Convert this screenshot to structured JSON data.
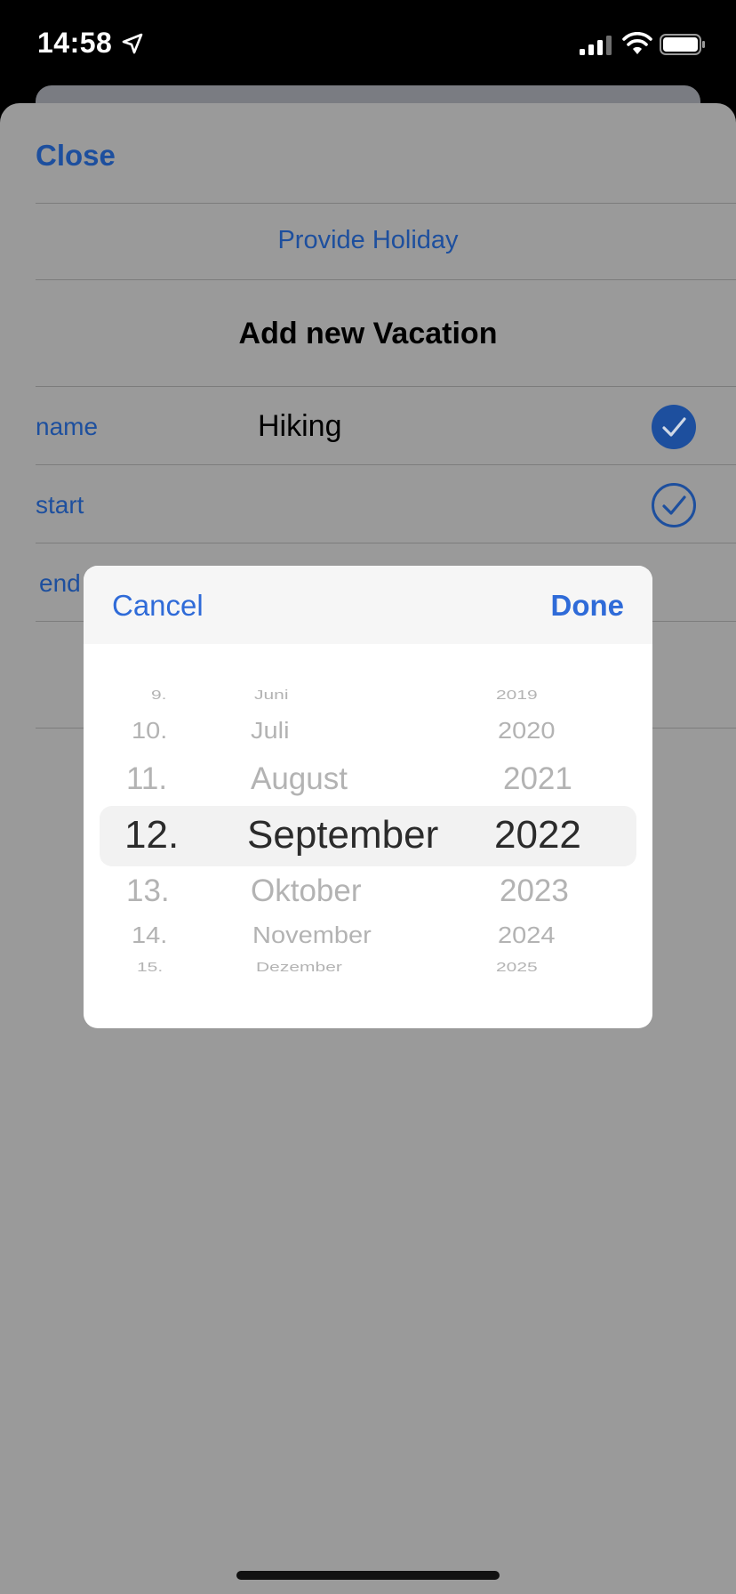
{
  "status_bar": {
    "time": "14:58"
  },
  "sheet": {
    "close_label": "Close",
    "provide_holiday_label": "Provide Holiday",
    "title": "Add new Vacation",
    "rows": [
      {
        "label": "name",
        "value": "Hiking",
        "check": "filled-check-icon"
      },
      {
        "label": "start",
        "value": "",
        "check": "outline-check-icon"
      },
      {
        "label": "end",
        "value": ""
      }
    ]
  },
  "picker": {
    "cancel_label": "Cancel",
    "done_label": "Done",
    "days": [
      "9.",
      "10.",
      "11.",
      "12.",
      "13.",
      "14.",
      "15."
    ],
    "months": [
      "Juni",
      "Juli",
      "August",
      "September",
      "Oktober",
      "November",
      "Dezember"
    ],
    "years": [
      "2019",
      "2020",
      "2021",
      "2022",
      "2023",
      "2024",
      "2025"
    ],
    "selected": {
      "day": "12.",
      "month": "September",
      "year": "2022"
    }
  },
  "colors": {
    "accent": "#2f6bd8",
    "dimmed_accent": "#1d4f9e",
    "check_fill": "#1d4f9e"
  }
}
